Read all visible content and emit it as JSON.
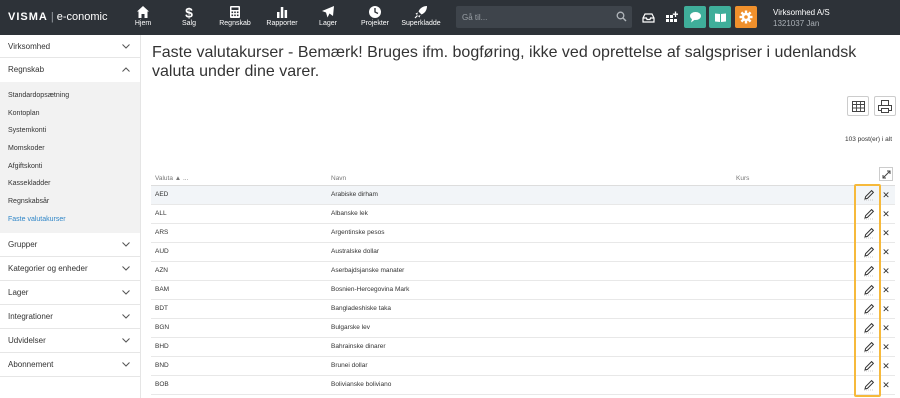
{
  "brand": {
    "name": "VISMA",
    "product": "e-conomic"
  },
  "nav": [
    {
      "label": "Hjem",
      "icon": "home-icon"
    },
    {
      "label": "Salg",
      "icon": "dollar-icon"
    },
    {
      "label": "Regnskab",
      "icon": "calculator-icon"
    },
    {
      "label": "Rapporter",
      "icon": "bar-chart-icon"
    },
    {
      "label": "Lager",
      "icon": "plane-icon"
    },
    {
      "label": "Projekter",
      "icon": "clock-icon"
    },
    {
      "label": "Superkladde",
      "icon": "rocket-icon"
    }
  ],
  "search": {
    "placeholder": "Gå til..."
  },
  "toolbar_icons": [
    "inbox-icon",
    "apps-icon",
    "chat-icon",
    "book-icon",
    "gear-icon"
  ],
  "colors": {
    "topbar": "#2d3238",
    "teal": "#3fae9a",
    "orange": "#f0902c",
    "active_link": "#2f86c8",
    "highlight": "#f6b93b"
  },
  "company": {
    "name": "Virksomhed A/S",
    "number": "1321037 Jan"
  },
  "sidebar": {
    "groups_top": [
      {
        "label": "Virksomhed"
      }
    ],
    "regnskab": {
      "label": "Regnskab",
      "items": [
        "Standardopsætning",
        "Kontoplan",
        "Systemkonti",
        "Momskoder",
        "Afgiftskonti",
        "Kassekladder",
        "Regnskabsår",
        "Faste valutakurser"
      ]
    },
    "groups_bottom": [
      {
        "label": "Grupper"
      },
      {
        "label": "Kategorier og enheder"
      },
      {
        "label": "Lager"
      },
      {
        "label": "Integrationer"
      },
      {
        "label": "Udvidelser"
      },
      {
        "label": "Abonnement"
      }
    ]
  },
  "page": {
    "title": "Faste valutakurser - Bemærk! Bruges ifm. bogføring, ikke ved oprettelse af salgspriser i udenlandsk valuta under dine varer.",
    "count": "103 post(er) i alt"
  },
  "table": {
    "headers": {
      "valuta": "Valuta",
      "sort": "▲ ...",
      "navn": "Navn",
      "kurs": "Kurs"
    },
    "rows": [
      {
        "code": "AED",
        "name": "Arabiske dirham"
      },
      {
        "code": "ALL",
        "name": "Albanske lek"
      },
      {
        "code": "ARS",
        "name": "Argentinske pesos"
      },
      {
        "code": "AUD",
        "name": "Australske dollar"
      },
      {
        "code": "AZN",
        "name": "Aserbajdsjanske manater"
      },
      {
        "code": "BAM",
        "name": "Bosnien-Hercegovina Mark"
      },
      {
        "code": "BDT",
        "name": "Bangladeshiske taka"
      },
      {
        "code": "BGN",
        "name": "Bulgarske lev"
      },
      {
        "code": "BHD",
        "name": "Bahrainske dinarer"
      },
      {
        "code": "BND",
        "name": "Brunei dollar"
      },
      {
        "code": "BOB",
        "name": "Bolivianske boliviano"
      }
    ]
  }
}
